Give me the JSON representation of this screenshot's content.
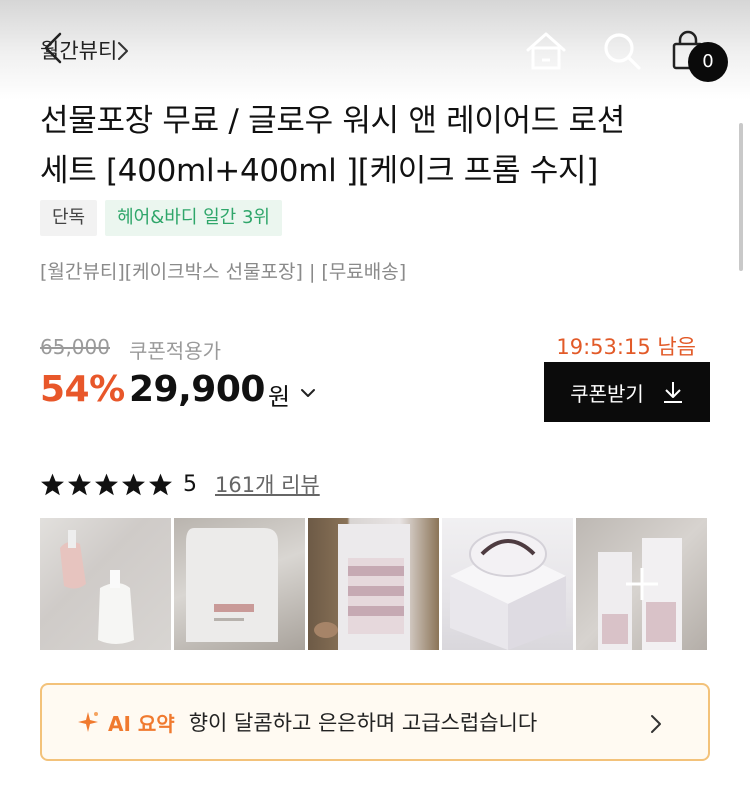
{
  "header": {
    "breadcrumb": "월간뷰티",
    "cart_count": "0"
  },
  "product": {
    "title_lines": [
      "선물포장 무료 / 글로우 워시 앤 레이어드 로션",
      "세트 [400ml+400ml ][케이크 프롬 수지]"
    ],
    "tags": [
      "단독",
      "헤어&바디 일간 3위"
    ],
    "description": "[월간뷰티][케이크박스 선물포장] | [무료배송]"
  },
  "pricing": {
    "original_price": "65,000",
    "coupon_note": "쿠폰적용가",
    "timer": "19:53:15 남음",
    "discount": "54%",
    "price": "29,900",
    "currency": "원",
    "coupon_button": "쿠폰받기"
  },
  "rating": {
    "stars": 5,
    "score": "5",
    "review_count": "161개 리뷰"
  },
  "photos": {
    "count": 5
  },
  "ai_summary": {
    "label": "AI 요약",
    "text": "향이 달콤하고 은은하며 고급스럽습니다"
  },
  "colors": {
    "accent": "#e8572a",
    "timer": "#e25a28",
    "tag_green": "#2fa66a",
    "ai_border": "#f3c27a"
  }
}
